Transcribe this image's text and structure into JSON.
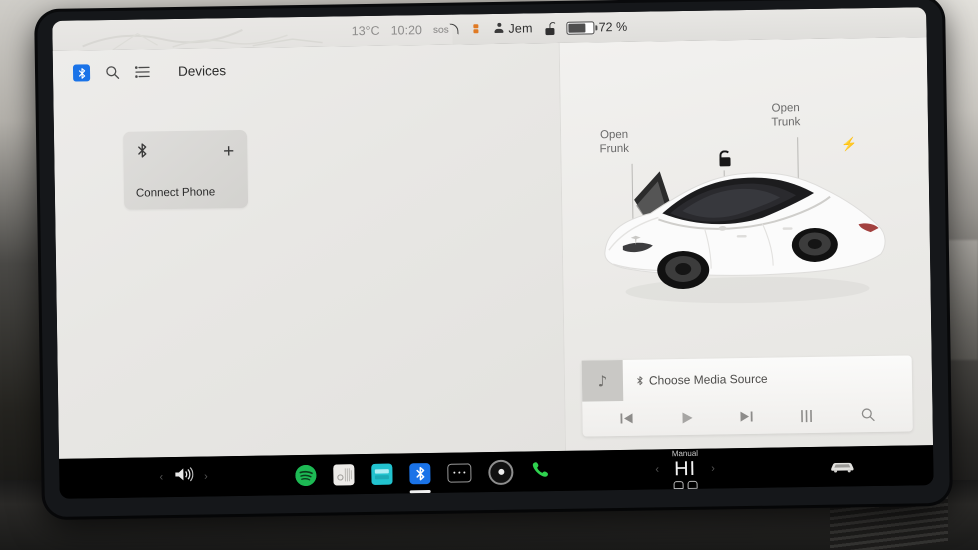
{
  "status_bar": {
    "temperature": "13°C",
    "clock": "10:20",
    "sos_label": "SOS",
    "driver_profile": "Jem",
    "battery_percent": "72 %",
    "battery_level": 72,
    "seat_heater_icon": "seat-heater-icon",
    "lock_icon": "unlocked-padlock-icon"
  },
  "devices_panel": {
    "title": "Devices",
    "bluetooth_icon": "bluetooth-icon",
    "search_icon": "search-icon",
    "list_icon": "list-settings-icon",
    "connect_card": {
      "label": "Connect Phone",
      "bluetooth_icon": "bluetooth-icon",
      "add_icon": "plus-icon"
    }
  },
  "car_panel": {
    "frunk_label_line1": "Open",
    "frunk_label_line2": "Frunk",
    "trunk_label_line1": "Open",
    "trunk_label_line2": "Trunk",
    "unlock_icon": "unlocked-padlock-icon",
    "charge_port_icon": "charge-bolt-icon",
    "vehicle_icon": "tesla-model-3-white"
  },
  "media_card": {
    "source_text": "Choose Media Source",
    "source_prefix_icon": "bluetooth-icon",
    "album_icon": "music-note-icon",
    "controls": [
      {
        "name": "previous-track-button",
        "icon": "previous-icon"
      },
      {
        "name": "play-button",
        "icon": "play-icon"
      },
      {
        "name": "next-track-button",
        "icon": "next-icon"
      },
      {
        "name": "equalizer-button",
        "icon": "equalizer-icon"
      },
      {
        "name": "media-search-button",
        "icon": "search-icon"
      }
    ]
  },
  "dock": {
    "volume": {
      "icon": "volume-icon",
      "left_chevron": "‹",
      "right_chevron": "›"
    },
    "apps": [
      {
        "name": "spotify-app",
        "label": "Spotify",
        "color": "#1db954",
        "active": false
      },
      {
        "name": "radio-app",
        "label": "Radio",
        "color": "#e6e5e2",
        "active": false
      },
      {
        "name": "tunein-app",
        "label": "TuneIn",
        "color": "#22c3cf",
        "active": false
      },
      {
        "name": "bluetooth-app",
        "label": "Bluetooth",
        "color": "#1a73e8",
        "active": true
      },
      {
        "name": "more-apps-button",
        "label": "More",
        "color": "#9a9a9a",
        "active": false
      },
      {
        "name": "dashcam-app",
        "label": "Camera",
        "color": "#8e8e8e",
        "active": false
      },
      {
        "name": "phone-app",
        "label": "Phone",
        "color": "#2fd24f",
        "active": false
      }
    ],
    "climate": {
      "mode": "Manual",
      "temperature": "HI",
      "left_chevron": "‹",
      "right_chevron": "›",
      "seat_icons": [
        "seat-heater-left-icon",
        "seat-heater-right-icon"
      ]
    },
    "car_button": {
      "name": "car-controls-button",
      "icon": "car-icon"
    }
  }
}
